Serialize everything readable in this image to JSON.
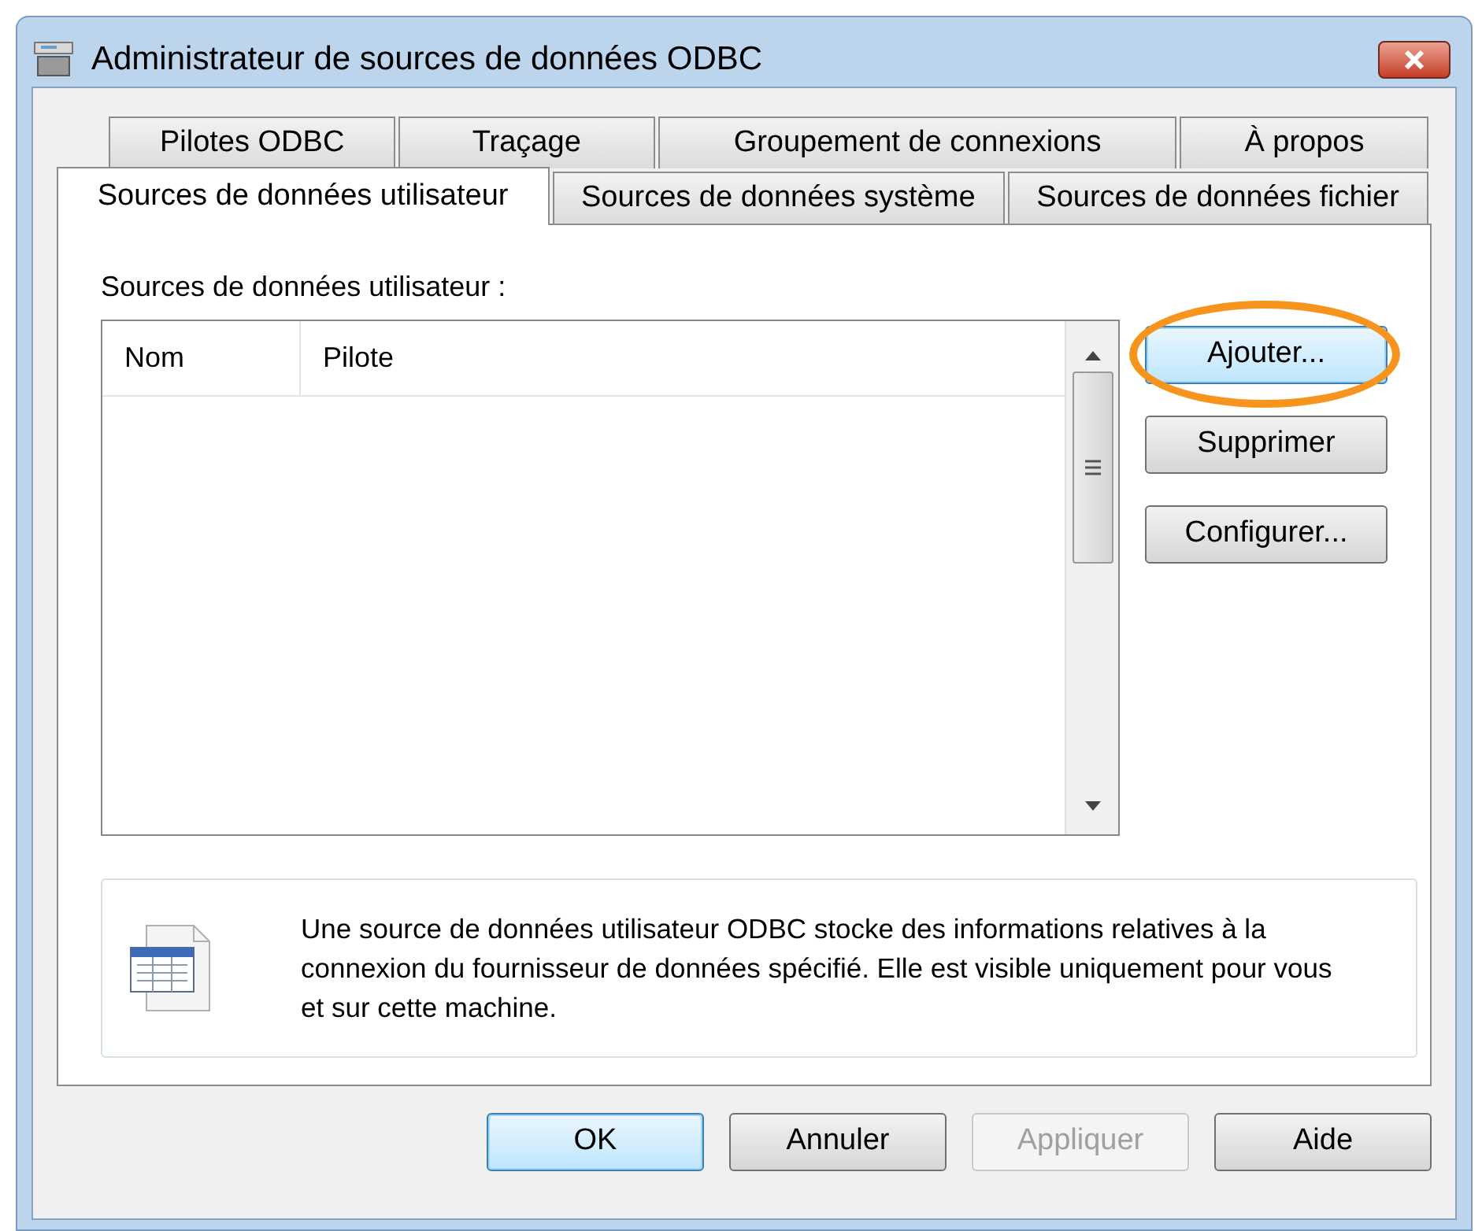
{
  "window": {
    "title": "Administrateur de sources de données ODBC"
  },
  "tab_rows": [
    [
      {
        "label": "Pilotes ODBC",
        "selected": false
      },
      {
        "label": "Traçage",
        "selected": false
      },
      {
        "label": "Groupement de connexions",
        "selected": false
      },
      {
        "label": "À propos",
        "selected": false
      }
    ],
    [
      {
        "label": "Sources de données utilisateur",
        "selected": true
      },
      {
        "label": "Sources de données système",
        "selected": false
      },
      {
        "label": "Sources de données fichier",
        "selected": false
      }
    ]
  ],
  "list": {
    "label": "Sources de données utilisateur :",
    "columns": [
      "Nom",
      "Pilote"
    ]
  },
  "side_buttons": [
    {
      "label": "Ajouter...",
      "focused": true,
      "highlighted": true
    },
    {
      "label": "Supprimer",
      "focused": false,
      "highlighted": false
    },
    {
      "label": "Configurer...",
      "focused": false,
      "highlighted": false
    }
  ],
  "info": "Une source de données utilisateur ODBC stocke des informations relatives à la connexion du fournisseur de données spécifié. Elle est visible uniquement pour vous et sur cette machine.",
  "footer_buttons": [
    {
      "label": "OK",
      "focused": true,
      "disabled": false
    },
    {
      "label": "Annuler",
      "focused": false,
      "disabled": false
    },
    {
      "label": "Appliquer",
      "focused": false,
      "disabled": true
    },
    {
      "label": "Aide",
      "focused": false,
      "disabled": false
    }
  ]
}
